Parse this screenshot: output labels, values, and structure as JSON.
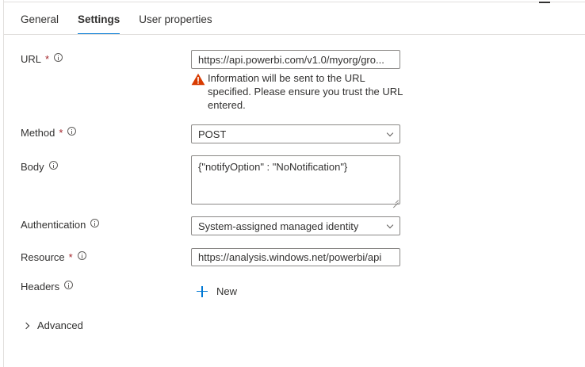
{
  "tabs": [
    {
      "label": "General",
      "active": false
    },
    {
      "label": "Settings",
      "active": true
    },
    {
      "label": "User properties",
      "active": false
    }
  ],
  "form": {
    "url": {
      "label": "URL",
      "required": "*",
      "value": "https://api.powerbi.com/v1.0/myorg/gro...",
      "warning": "Information will be sent to the URL specified. Please ensure you trust the URL entered."
    },
    "method": {
      "label": "Method",
      "required": "*",
      "value": "POST"
    },
    "body": {
      "label": "Body",
      "value": "{\"notifyOption\" : \"NoNotification\"}"
    },
    "authentication": {
      "label": "Authentication",
      "value": "System-assigned managed identity"
    },
    "resource": {
      "label": "Resource",
      "required": "*",
      "value": "https://analysis.windows.net/powerbi/api"
    },
    "headers": {
      "label": "Headers",
      "new_label": "New"
    },
    "advanced": {
      "label": "Advanced"
    }
  },
  "icons": {
    "info": "info-circle-icon",
    "warning": "warning-triangle-icon",
    "dropdown": "chevron-down-icon",
    "add": "plus-icon",
    "expand": "chevron-right-icon"
  },
  "colors": {
    "accent": "#0078d4",
    "required": "#a4262c",
    "warning": "#d83b01"
  }
}
